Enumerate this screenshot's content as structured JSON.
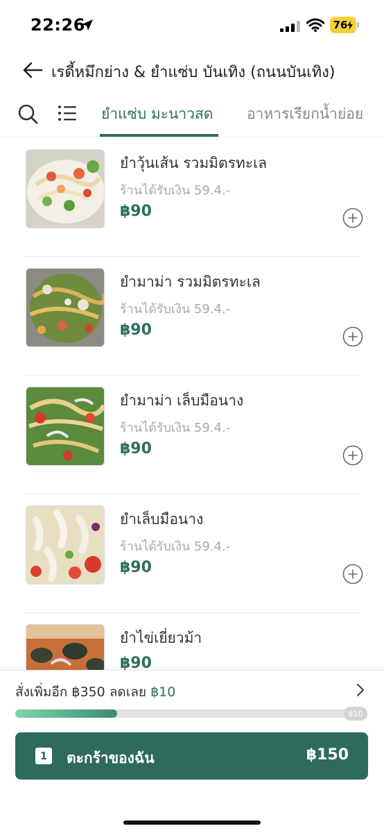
{
  "status_bar": {
    "time": "22:26",
    "battery": "76"
  },
  "header": {
    "store_name": "เรดี้หมึกย่าง & ยำแซ่บ บันเทิง (ถนนบันเทิง)"
  },
  "categories": {
    "active": "ยำแซ่บ มะนาวสด",
    "next": "อาหารเรียกน้ำย่อย"
  },
  "items": [
    {
      "name": "ยำวุ้นเส้น รวมมิตรทะเล",
      "earnings": "ร้านได้รับเงิน 59.4.-",
      "price": "฿90"
    },
    {
      "name": "ยำมาม่า รวมมิตรทะเล",
      "earnings": "ร้านได้รับเงิน 59.4.-",
      "price": "฿90"
    },
    {
      "name": "ยำมาม่า เล็บมือนาง",
      "earnings": "ร้านได้รับเงิน 59.4.-",
      "price": "฿90"
    },
    {
      "name": "ยำเล็บมือนาง",
      "earnings": "ร้านได้รับเงิน 59.4.-",
      "price": "฿90"
    },
    {
      "name": "ยำไข่เยี่ยวม้า",
      "earnings": "",
      "price": "฿90"
    }
  ],
  "promo": {
    "text": "สั่งเพิ่มอีก ฿350 ลดเลย ",
    "discount": "฿10",
    "progress": 0.29,
    "badge": "฿10"
  },
  "cart": {
    "count": "1",
    "label": "ตะกร้าของฉัน",
    "total": "฿150"
  },
  "colors": {
    "brand": "#2f6e5e",
    "muted": "#a9a9a9"
  }
}
